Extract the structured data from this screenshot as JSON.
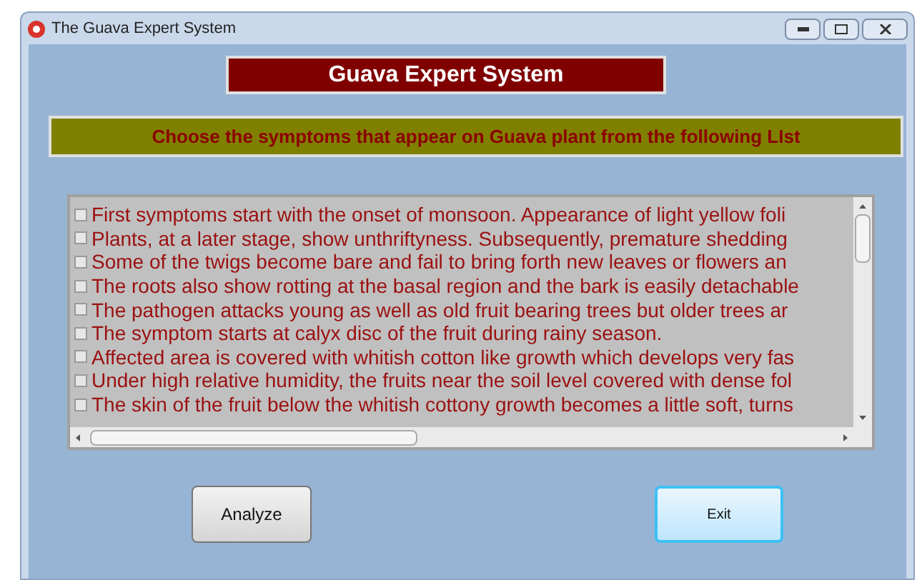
{
  "window": {
    "title": "The Guava Expert System"
  },
  "heading": "Guava Expert System",
  "instruction": "Choose the symptoms that appear on Guava plant from the following LIst",
  "symptoms": [
    {
      "text": "First symptoms start with the onset of monsoon. Appearance of light yellow foli",
      "checked": false
    },
    {
      "text": "Plants, at a later stage, show unthriftyness. Subsequently, premature shedding",
      "checked": false
    },
    {
      "text": "Some of the twigs become bare and fail to bring forth new leaves or flowers an",
      "checked": false
    },
    {
      "text": "The roots also show rotting at the basal region and the bark is easily detachable",
      "checked": false
    },
    {
      "text": "The pathogen attacks young as well as old fruit bearing trees but older trees ar",
      "checked": false
    },
    {
      "text": "The symptom starts at calyx disc of the fruit during rainy season.",
      "checked": false
    },
    {
      "text": "Affected area is covered with whitish cotton like growth which develops very fas",
      "checked": false
    },
    {
      "text": "Under high relative humidity, the fruits near the soil level covered with dense fol",
      "checked": false
    },
    {
      "text": "The skin of the fruit below the whitish cottony growth becomes a little soft, turns",
      "checked": false
    }
  ],
  "buttons": [
    {
      "label": "Analyze",
      "kind": "normal"
    },
    {
      "label": "Exit",
      "kind": "focused"
    }
  ]
}
